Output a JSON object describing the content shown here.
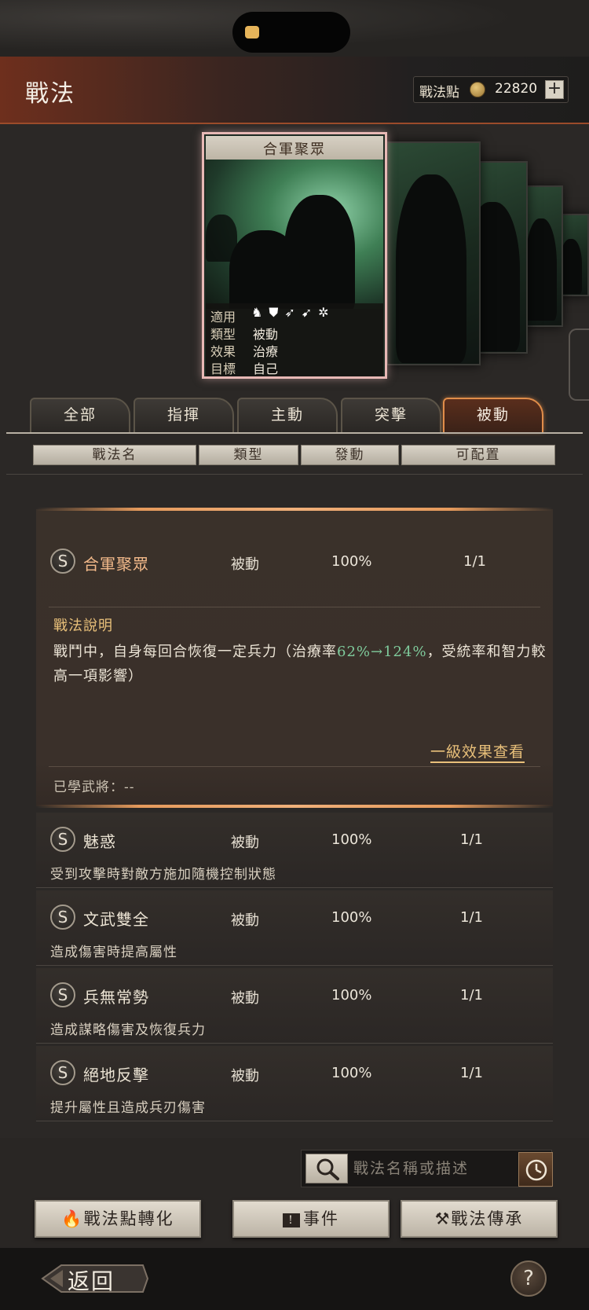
{
  "header": {
    "title": "戰法",
    "points_label": "戰法點",
    "points_value": "22820",
    "plus_label": "+"
  },
  "featured_card": {
    "title": "合軍聚眾",
    "info": [
      {
        "key": "適用",
        "value": ""
      },
      {
        "key": "類型",
        "value": "被動"
      },
      {
        "key": "效果",
        "value": "治療"
      },
      {
        "key": "目標",
        "value": "自己"
      }
    ],
    "applicable_icons": [
      "cavalry-icon",
      "shield-icon",
      "bow-icon",
      "spear-icon",
      "chariot-wheel-icon"
    ]
  },
  "tabs": [
    {
      "label": "全部",
      "active": false
    },
    {
      "label": "指揮",
      "active": false
    },
    {
      "label": "主動",
      "active": false
    },
    {
      "label": "突擊",
      "active": false
    },
    {
      "label": "被動",
      "active": true
    }
  ],
  "columns": [
    "戰法名",
    "類型",
    "發動",
    "可配置"
  ],
  "expanded": {
    "grade": "S",
    "name": "合軍聚眾",
    "type": "被動",
    "rate": "100%",
    "count": "1/1",
    "desc_title": "戰法說明",
    "desc_pre": "戰鬥中，自身每回合恢復一定兵力（治療率",
    "desc_green": "62%→124%",
    "desc_post": "，受統率和智力較高一項影響）",
    "effect_link": "一級效果查看",
    "learned": "已學武將：--"
  },
  "items": [
    {
      "grade": "S",
      "name": "魅惑",
      "type": "被動",
      "rate": "100%",
      "count": "1/1",
      "desc": "受到攻擊時對敵方施加隨機控制狀態"
    },
    {
      "grade": "S",
      "name": "文武雙全",
      "type": "被動",
      "rate": "100%",
      "count": "1/1",
      "desc": "造成傷害時提高屬性"
    },
    {
      "grade": "S",
      "name": "兵無常勢",
      "type": "被動",
      "rate": "100%",
      "count": "1/1",
      "desc": "造成謀略傷害及恢復兵力"
    },
    {
      "grade": "S",
      "name": "絕地反擊",
      "type": "被動",
      "rate": "100%",
      "count": "1/1",
      "desc": "提升屬性且造成兵刃傷害"
    }
  ],
  "search": {
    "placeholder": "戰法名稱或描述"
  },
  "buttons": {
    "convert": "戰法點轉化",
    "events": "事件",
    "inherit": "戰法傳承"
  },
  "footer": {
    "back": "返回",
    "help": "?"
  },
  "colors": {
    "accent": "#e08d4a",
    "gold": "#e9c07a",
    "green": "#7fcb9c",
    "card_border": "#e7b8b5"
  }
}
